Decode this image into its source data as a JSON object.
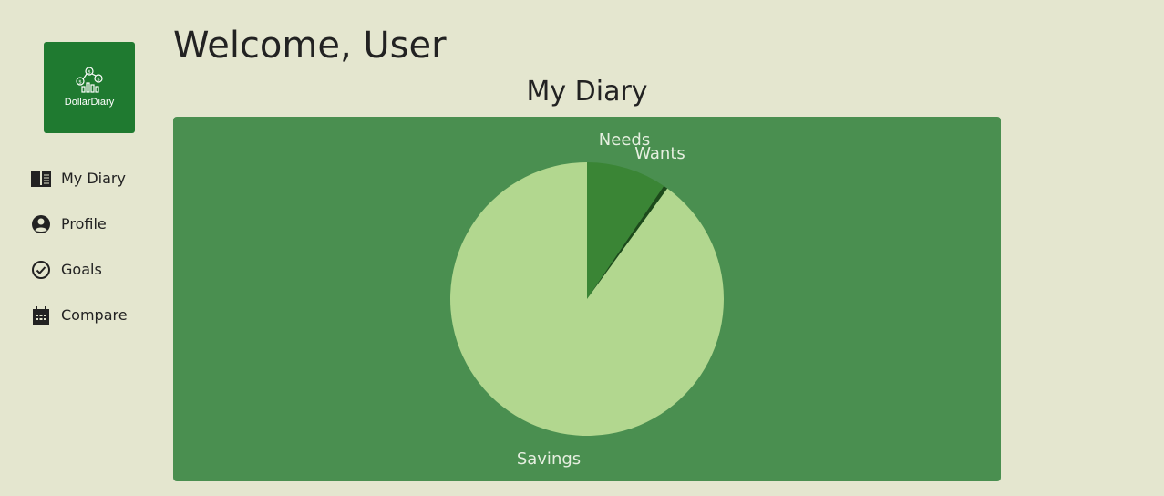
{
  "logo": {
    "text": "DollarDiary"
  },
  "nav": [
    {
      "label": "My Diary",
      "icon": "book-open-icon"
    },
    {
      "label": "Profile",
      "icon": "user-circle-icon"
    },
    {
      "label": "Goals",
      "icon": "check-circle-icon"
    },
    {
      "label": "Compare",
      "icon": "calendar-icon"
    }
  ],
  "header": {
    "welcome": "Welcome, User"
  },
  "chart": {
    "title": "My Diary"
  },
  "chart_data": {
    "type": "pie",
    "title": "My Diary",
    "categories": [
      "Needs",
      "Wants",
      "Savings"
    ],
    "values": [
      9.5,
      0.5,
      90
    ],
    "colors": [
      "#3a8535",
      "#1d4a1b",
      "#b2d78f"
    ]
  },
  "colors": {
    "background": "#e4e6cf",
    "logo_bg": "#1f7a30",
    "panel_bg": "#4a8f50"
  }
}
